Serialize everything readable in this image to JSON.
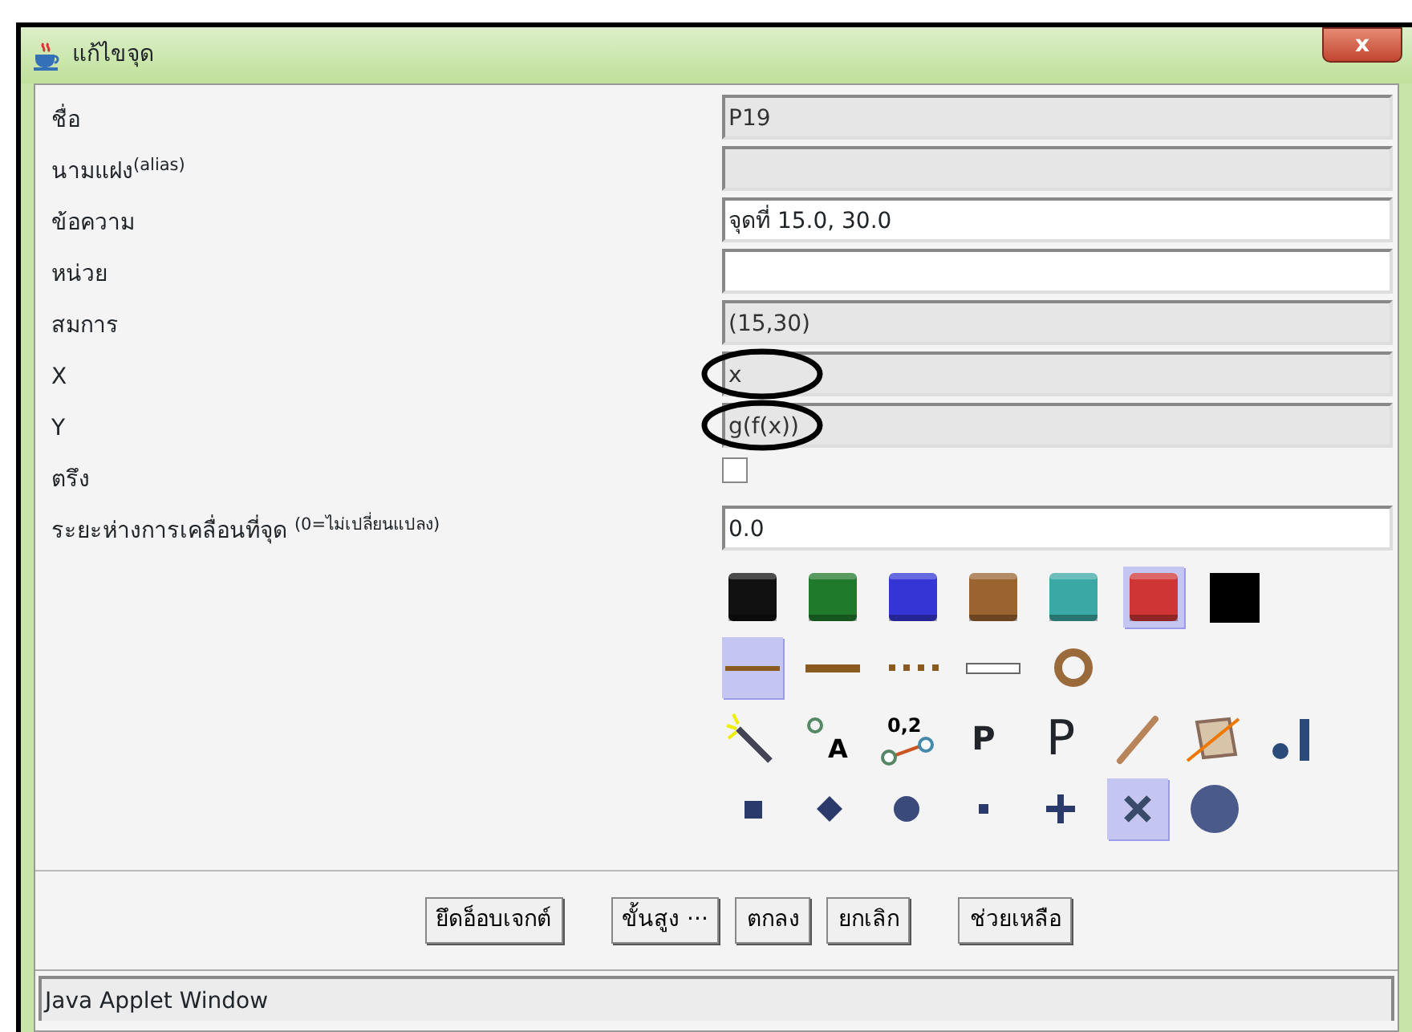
{
  "window": {
    "title": "แก้ไขจุด",
    "close_label": "x"
  },
  "fields": [
    {
      "label": "ชื่อ",
      "kind": "text",
      "value": "P19",
      "disabled": true
    },
    {
      "label": "นามแฝง$^{(alias)}$",
      "kind": "text",
      "disabled": true
    },
    {
      "label": "ข้อความ",
      "kind": "text",
      "value": "จุดที่   15.0,   30.0",
      "disabled": false
    },
    {
      "label": "หน่วย",
      "kind": "text",
      "disabled": false
    },
    {
      "label": "สมการ",
      "kind": "text",
      "value": "(15,30)",
      "disabled": true
    },
    {
      "label": "X",
      "kind": "text",
      "value": "x",
      "disabled": true,
      "circled": true
    },
    {
      "label": "Y",
      "kind": "text",
      "value": "g(f(x))",
      "disabled": true,
      "circled": true
    },
    {
      "label": "ตรึง",
      "kind": "checkbox",
      "checked": false
    },
    {
      "label": "ระยะห่างการเคลื่อนที่จุด $^{(0=ไม่เปลี่ยนแปลง)}$",
      "kind": "text",
      "value": "0.0",
      "disabled": false
    }
  ],
  "colors": [
    {
      "color": "#111111",
      "selected": false,
      "kind": "bevel"
    },
    {
      "color": "#1f7a2c",
      "selected": false,
      "kind": "bevel"
    },
    {
      "color": "#3535d6",
      "selected": false,
      "kind": "bevel"
    },
    {
      "color": "#9a6430",
      "selected": false,
      "kind": "bevel"
    },
    {
      "color": "#3aa8a4",
      "selected": false,
      "kind": "bevel"
    },
    {
      "color": "#d03535",
      "selected": true,
      "kind": "bevel"
    },
    {
      "color": "#000000",
      "selected": false,
      "kind": "flat"
    }
  ],
  "line_styles": [
    {
      "kind": "thin",
      "selected": true
    },
    {
      "kind": "thick",
      "selected": false
    },
    {
      "kind": "dotted",
      "selected": false
    },
    {
      "kind": "white",
      "selected": false
    },
    {
      "kind": "ring",
      "selected": false
    }
  ],
  "tools": [
    {
      "kind": "wand"
    },
    {
      "kind": "label",
      "text": "A"
    },
    {
      "kind": "value",
      "text": "0,2"
    },
    {
      "kind": "bold-p",
      "text": "P"
    },
    {
      "kind": "thin-p",
      "text": "P"
    },
    {
      "kind": "segment"
    },
    {
      "kind": "polygon"
    },
    {
      "kind": "bar"
    }
  ],
  "point_styles": [
    {
      "kind": "square",
      "selected": false
    },
    {
      "kind": "diamond",
      "selected": false
    },
    {
      "kind": "dot",
      "selected": false
    },
    {
      "kind": "small",
      "selected": false
    },
    {
      "kind": "plus",
      "selected": false
    },
    {
      "kind": "cross",
      "selected": true
    },
    {
      "kind": "big",
      "selected": false
    }
  ],
  "buttons": [
    "ยึดอ็อบเจกต์",
    "ขั้นสูง ···",
    "ตกลง",
    "ยกเลิก",
    "ช่วยเหลือ"
  ],
  "status_bar": "Java Applet Window"
}
